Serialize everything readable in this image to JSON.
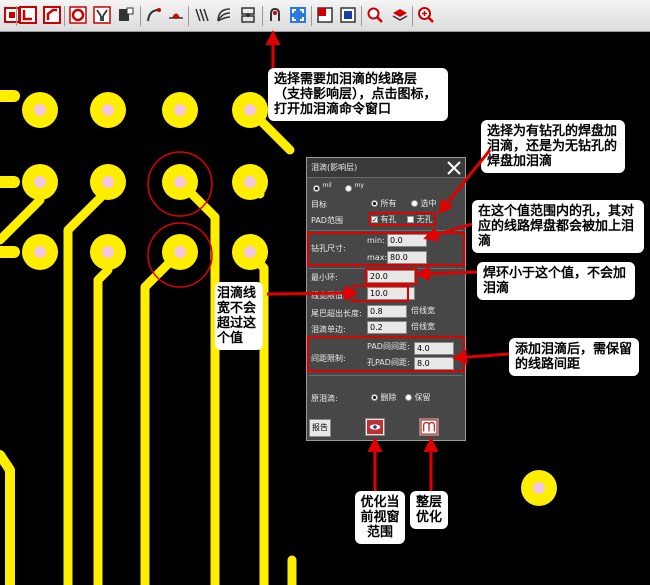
{
  "toolbar": {
    "icons": [
      "area-select-icon",
      "line-tool-icon",
      "corner-tool-icon",
      "via-icon",
      "stitch-icon",
      "copper-pour-icon",
      "arc-tool-icon",
      "teardrop-line-icon",
      "diff-pair-icon",
      "arc-route-icon",
      "shape-icon",
      "teardrop-icon",
      "fit-view-icon",
      "layer-toggle-icon",
      "fill-icon",
      "zoom-icon",
      "layer-stack-icon",
      "zoom-in-icon"
    ]
  },
  "dialog": {
    "title": "泪滴(影响层)",
    "unit_mil": "mil",
    "unit_my": "my",
    "target_label": "目标",
    "target_all": "所有",
    "target_selected": "选中",
    "pad_range_label": "PAD范围",
    "pad_with_hole": "有孔",
    "pad_no_hole": "无孔",
    "drill_label": "钻孔尺寸:",
    "min_label": "min:",
    "min_value": "0.0",
    "max_label": "max:",
    "max_value": "80.0",
    "min_ring_label": "最小环:",
    "min_ring_value": "20.0",
    "line_width_label": "线宽限值:",
    "line_width_value": "10.0",
    "tail_label": "尾巴超出长度:",
    "tail_value": "0.8",
    "tail_unit": "倍线宽",
    "single_side_label": "泪滴单边:",
    "single_side_value": "0.2",
    "single_side_unit": "倍线宽",
    "spacing_label": "间距限制:",
    "pad_pad_label": "PAD间间距:",
    "pad_pad_value": "4.0",
    "hole_pad_label": "孔PAD间距:",
    "hole_pad_value": "8.0",
    "original_label": "原泪滴:",
    "delete_label": "删除",
    "keep_label": "保留",
    "report_button": "报告"
  },
  "callouts": {
    "select_layer": "选择需要加泪滴的线路层（支持影响层），点击图标，打开加泪滴命令窗口",
    "pad_type": "选择为有钻孔的焊盘加泪滴，还是为无钻孔的焊盘加泪滴",
    "hole_range": "在这个值范围内的孔，其对应的线路焊盘都会被加上泪滴",
    "ring": "焊环小于这个值，不会加泪滴",
    "line_width": "泪滴线宽不会超过这个值",
    "spacing": "添加泪滴后，需保留的线路间距",
    "optimize_view": "优化当前视窗范围",
    "optimize_layer": "整层优化"
  },
  "colors": {
    "trace": "#ffee00",
    "pad_center": "#f4c8e0",
    "accent_red": "#e00000",
    "dialog_bg": "#474747"
  }
}
